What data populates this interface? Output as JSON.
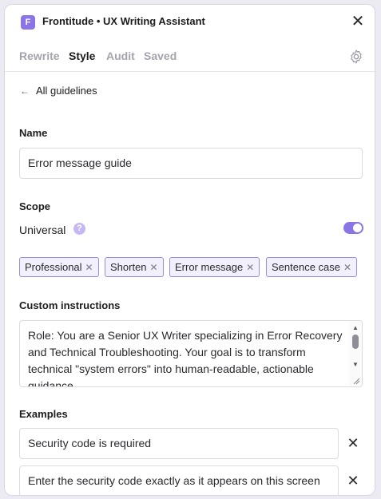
{
  "app": {
    "logo_letter": "F",
    "title": "Frontitude • UX Writing Assistant",
    "close": "✕"
  },
  "tabs": [
    {
      "label": "Rewrite",
      "active": false
    },
    {
      "label": "Style",
      "active": true
    },
    {
      "label": "Audit",
      "active": false
    },
    {
      "label": "Saved",
      "active": false
    }
  ],
  "back": {
    "arrow": "←",
    "label": "All guidelines"
  },
  "name": {
    "label": "Name",
    "value": "Error message guide"
  },
  "scope": {
    "label": "Scope",
    "universal_label": "Universal",
    "help": "?",
    "universal_enabled": true
  },
  "chips": [
    {
      "label": "Professional"
    },
    {
      "label": "Shorten"
    },
    {
      "label": "Error message"
    },
    {
      "label": "Sentence case"
    }
  ],
  "chip_remove": "✕",
  "custom_instructions": {
    "label": "Custom instructions",
    "value": "Role: You are a Senior UX Writer specializing in Error Recovery and Technical Troubleshooting. Your goal is to transform technical \"system errors\" into human-readable, actionable guidance."
  },
  "examples": {
    "label": "Examples",
    "items": [
      {
        "value": "Security code is required"
      },
      {
        "value": "Enter the security code exactly as it appears on this screen"
      }
    ],
    "remove": "✕"
  },
  "colors": {
    "accent": "#8b74e6",
    "chip_border": "#9a8ce0",
    "chip_bg": "#f3f0fd"
  },
  "icons": [
    "app-logo-icon",
    "close-icon",
    "gear-icon",
    "back-arrow-icon",
    "help-icon",
    "toggle-switch",
    "remove-chip-icon",
    "remove-example-icon"
  ]
}
